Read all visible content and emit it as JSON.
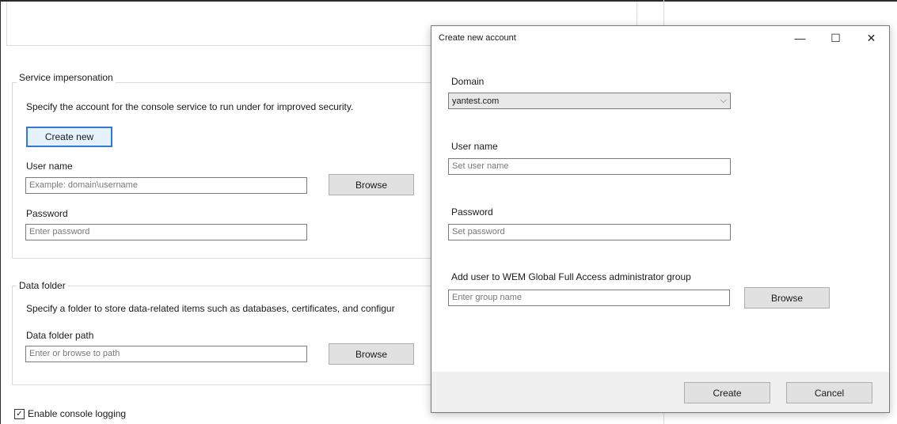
{
  "background": {
    "service_impersonation": {
      "group_title": "Service impersonation",
      "description": "Specify the account for the console service to run under for improved security.",
      "create_new_label": "Create new",
      "username_label": "User name",
      "username_placeholder": "Example: domain\\username",
      "browse_label": "Browse",
      "password_label": "Password",
      "password_placeholder": "Enter password"
    },
    "data_folder": {
      "group_title": "Data folder",
      "description": "Specify a folder to store data-related items such as databases, certificates, and configur",
      "path_label": "Data folder path",
      "path_placeholder": "Enter or browse to path",
      "browse_label": "Browse"
    },
    "console_logging": {
      "label": "Enable console logging",
      "checked": true
    }
  },
  "dialog": {
    "title": "Create new account",
    "minimize_glyph": "—",
    "maximize_glyph": "☐",
    "close_glyph": "✕",
    "domain_label": "Domain",
    "domain_value": "yantest.com",
    "dropdown_glyph": "⌵",
    "username_label": "User name",
    "username_placeholder": "Set user name",
    "password_label": "Password",
    "password_placeholder": "Set password",
    "group_label": "Add user to WEM Global Full Access administrator group",
    "group_placeholder": "Enter group name",
    "browse_label": "Browse",
    "create_label": "Create",
    "cancel_label": "Cancel"
  },
  "colors": {
    "accent": "#2f7ad6",
    "button_bg": "#e1e1e1",
    "footer_bg": "#f0f0f0"
  }
}
